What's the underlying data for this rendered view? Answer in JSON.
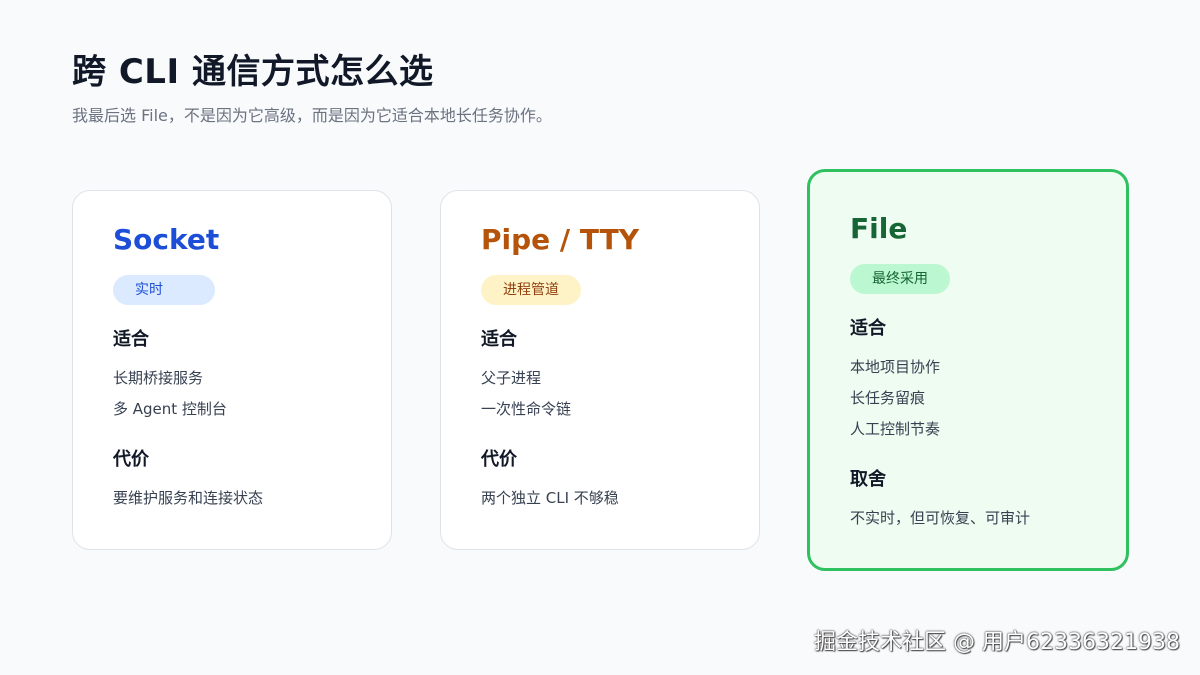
{
  "header": {
    "title": "跨 CLI 通信方式怎么选",
    "subtitle": "我最后选 File，不是因为它高级，而是因为它适合本地长任务协作。"
  },
  "cards": [
    {
      "title": "Socket",
      "badge": "实时",
      "fit_label": "适合",
      "fit_items": [
        "长期桥接服务",
        "多 Agent 控制台"
      ],
      "cost_label": "代价",
      "cost_items": [
        "要维护服务和连接状态"
      ]
    },
    {
      "title": "Pipe / TTY",
      "badge": "进程管道",
      "fit_label": "适合",
      "fit_items": [
        "父子进程",
        "一次性命令链"
      ],
      "cost_label": "代价",
      "cost_items": [
        "两个独立 CLI 不够稳"
      ]
    },
    {
      "title": "File",
      "badge": "最终采用",
      "fit_label": "适合",
      "fit_items": [
        "本地项目协作",
        "长任务留痕",
        "人工控制节奏"
      ],
      "cost_label": "取舍",
      "cost_items": [
        "不实时，但可恢复、可审计"
      ]
    }
  ],
  "watermark": "掘金技术社区 @ 用户62336321938",
  "colors": {
    "socket": "#1d4ed8",
    "pipe": "#b45309",
    "file": "#166534",
    "file_border": "#2fc05f"
  }
}
